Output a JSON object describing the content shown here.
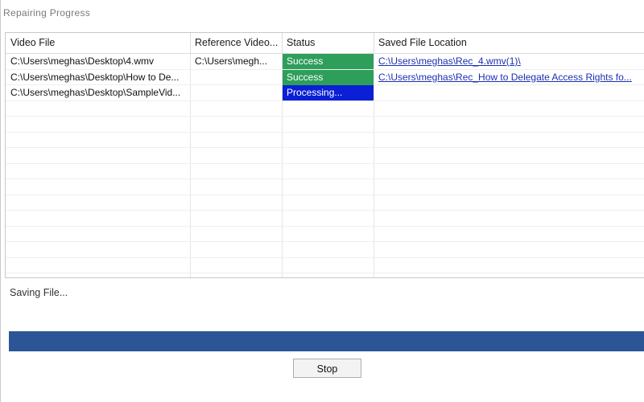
{
  "window": {
    "title": "Repairing Progress"
  },
  "table": {
    "columns": [
      "Video File",
      "Reference Video...",
      "Status",
      "Saved File Location"
    ],
    "rows": [
      {
        "video_file": "C:\\Users\\meghas\\Desktop\\4.wmv",
        "reference": "C:\\Users\\megh...",
        "status": "Success",
        "saved": "C:\\Users\\meghas\\Rec_4.wmv(1)\\"
      },
      {
        "video_file": "C:\\Users\\meghas\\Desktop\\How to De...",
        "reference": "",
        "status": "Success",
        "saved": "C:\\Users\\meghas\\Rec_How to Delegate Access Rights fo..."
      },
      {
        "video_file": "C:\\Users\\meghas\\Desktop\\SampleVid...",
        "reference": "",
        "status": "Processing...",
        "saved": ""
      }
    ],
    "empty_rows": 11
  },
  "status_text": "Saving File...",
  "progress": {
    "fraction": 1.0
  },
  "buttons": {
    "stop": "Stop"
  },
  "colors": {
    "success": "#2e9e5b",
    "processing": "#0a1fd6",
    "progress": "#2b5597",
    "link": "#1a2fb0"
  }
}
